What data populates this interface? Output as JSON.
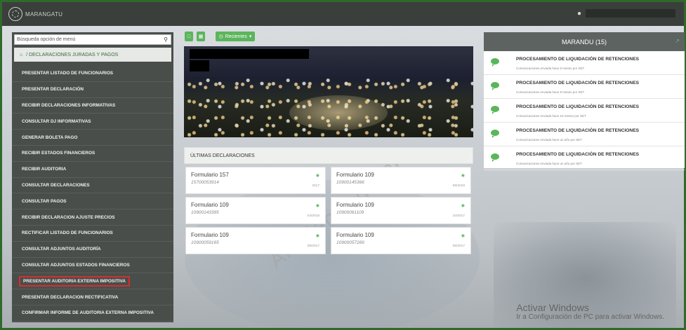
{
  "app": {
    "logo_text": "MARANGATU"
  },
  "sidebar": {
    "search_placeholder": "Búsqueda opción de menú",
    "breadcrumb": "/ DECLARACIONES JURADAS Y PAGOS",
    "items": [
      {
        "label": "PRESENTAR LISTADO DE FUNCIONARIOS"
      },
      {
        "label": "PRESENTAR DECLARACIÓN"
      },
      {
        "label": "RECIBIR DECLARACIONES INFORMATIVAS"
      },
      {
        "label": "CONSULTAR DJ INFORMATIVAS"
      },
      {
        "label": "GENERAR BOLETA PAGO"
      },
      {
        "label": "RECIBIR ESTADOS FINANCIEROS"
      },
      {
        "label": "RECIBIR AUDITORIA"
      },
      {
        "label": "CONSULTAR DECLARACIONES"
      },
      {
        "label": "CONSULTAR PAGOS"
      },
      {
        "label": "RECIBIR DECLARACION AJUSTE PRECIOS"
      },
      {
        "label": "RECTIFICAR LISTADO DE FUNCIONARIOS"
      },
      {
        "label": "CONSULTAR ADJUNTOS AUDITORÍA"
      },
      {
        "label": "CONSULTAR ADJUNTOS ESTADOS FINANCIEROS"
      },
      {
        "label": "PRESENTAR AUDITORIA EXTERNA IMPOSITIVA",
        "highlighted": true
      },
      {
        "label": "PRESENTAR DECLARACION RECTIFICATIVA"
      },
      {
        "label": "CONFIRMAR INFORME DE AUDITORIA EXTERNA IMPOSITIVA"
      }
    ]
  },
  "toolbar": {
    "recientes_label": "Recientes"
  },
  "declarations": {
    "header": "ÚLTIMAS DECLARACIONES",
    "cards": [
      {
        "title": "Formulario 157",
        "number": "15700053914",
        "date": "2017"
      },
      {
        "title": "Formulario 109",
        "number": "10900145366",
        "date": "09/2018"
      },
      {
        "title": "Formulario 109",
        "number": "10900143395",
        "date": "04/2018"
      },
      {
        "title": "Formulario 109",
        "number": "10900061109",
        "date": "10/2017"
      },
      {
        "title": "Formulario 109",
        "number": "10900059165",
        "date": "09/2017"
      },
      {
        "title": "Formulario 109",
        "number": "10900057289",
        "date": "08/2017"
      }
    ]
  },
  "notifications": {
    "title": "MARANDU (15)",
    "items": [
      {
        "title": "PROCESAMIENTO DE LIQUIDACIÓN DE RETENCIONES",
        "subtitle": "Comunicaciones enviada hace 8 meses por SET"
      },
      {
        "title": "PROCESAMIENTO DE LIQUIDACIÓN DE RETENCIONES",
        "subtitle": "Comunicaciones enviada hace 9 meses por SET"
      },
      {
        "title": "PROCESAMIENTO DE LIQUIDACIÓN DE RETENCIONES",
        "subtitle": "Comunicaciones enviada hace 10 meses por SET"
      },
      {
        "title": "PROCESAMIENTO DE LIQUIDACIÓN DE RETENCIONES",
        "subtitle": "Comunicaciones enviada hace un año por SET"
      },
      {
        "title": "PROCESAMIENTO DE LIQUIDACIÓN DE RETENCIONES",
        "subtitle": "Comunicaciones enviada hace un año por SET"
      }
    ]
  },
  "overlay": {
    "watermark": "Ambiente de Pr",
    "activate_title": "Activar Windows",
    "activate_sub": "Ir a Configuración de PC para activar Windows."
  },
  "colors": {
    "accent_green": "#5bb55b",
    "highlight_red": "#d23030",
    "sidebar_bg": "#4a4e4b"
  }
}
